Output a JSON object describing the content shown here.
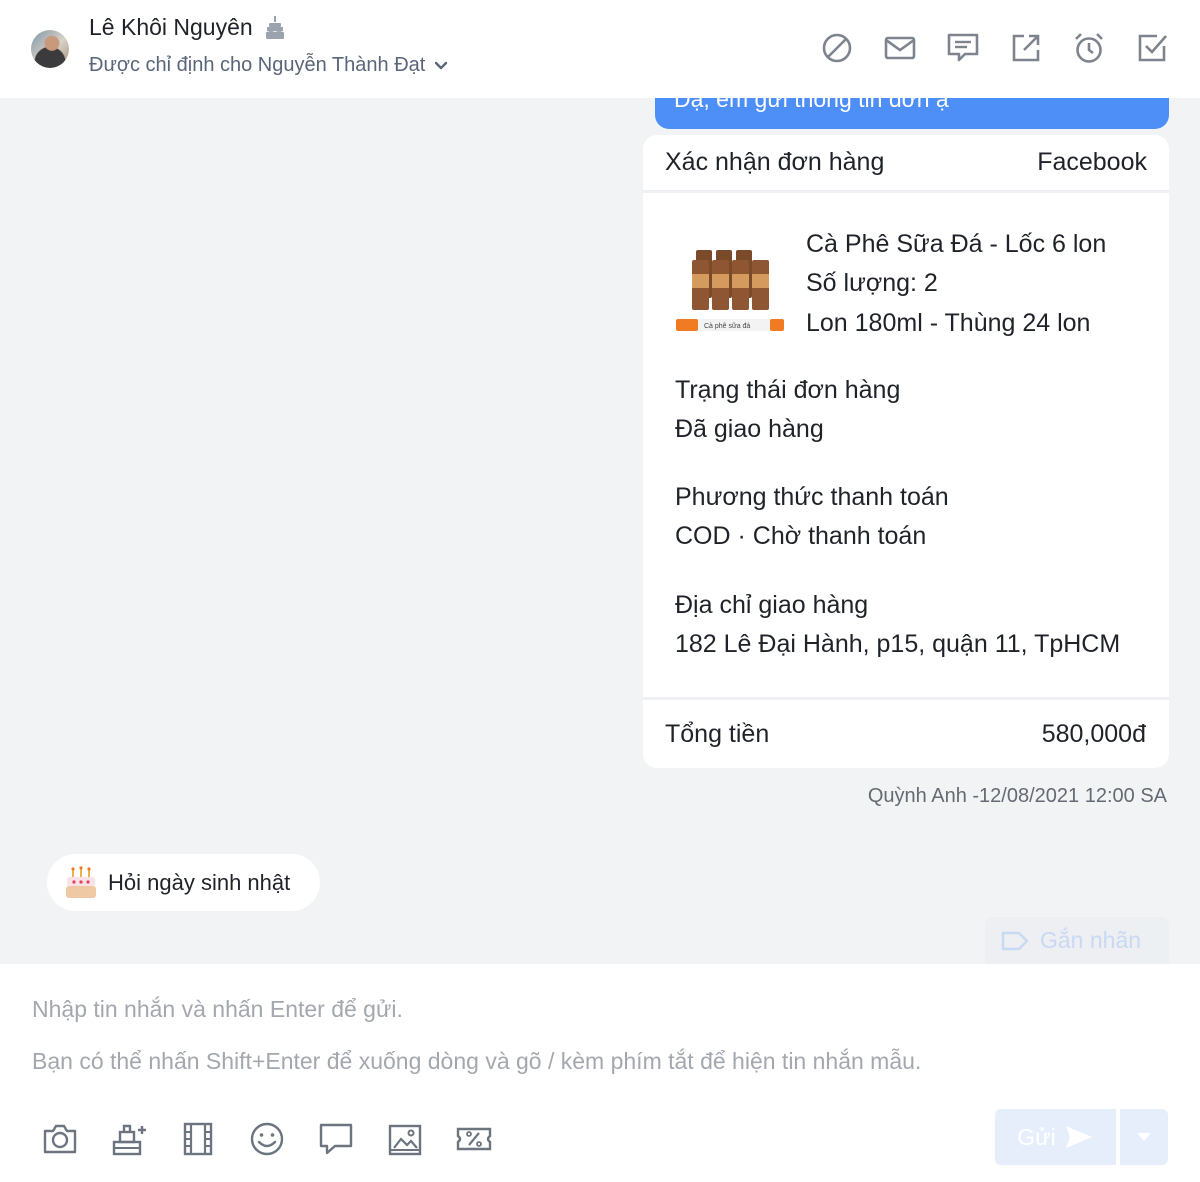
{
  "header": {
    "contact_name": "Lê Khôi Nguyên",
    "assigned_to": "Được chỉ định cho Nguyễn Thành Đạt",
    "icons": [
      "block-icon",
      "mail-icon",
      "comment-icon",
      "open-external-icon",
      "alarm-icon",
      "check-square-icon"
    ]
  },
  "conversation": {
    "top_bubble_text": "Dạ, em gửi thông tin đơn ạ",
    "order_card": {
      "title": "Xác nhận đơn hàng",
      "channel": "Facebook",
      "product": {
        "name": "Cà Phê Sữa Đá - Lốc 6 lon",
        "quantity": "Số lượng: 2",
        "variant": "Lon 180ml - Thùng 24 lon",
        "image_caption": "Cà phê sữa đá"
      },
      "status_label": "Trạng thái đơn hàng",
      "status_value": "Đã giao hàng",
      "payment_label": "Phương thức thanh toán",
      "payment_value": "COD · Chờ thanh toán",
      "address_label": "Địa chỉ giao hàng",
      "address_value": "182 Lê Đại Hành, p15, quận 11, TpHCM",
      "total_label": "Tổng tiền",
      "total_value": "580,000đ"
    },
    "message_meta": "Quỳnh Anh -12/08/2021 12:00 SA",
    "suggestion_chip": "Hỏi ngày sinh nhật",
    "tag_button": "Gắn nhãn"
  },
  "composer": {
    "placeholder_line1": "Nhập tin nhắn và nhấn Enter để gửi.",
    "placeholder_line2": "Bạn có thể nhấn Shift+Enter để xuống dòng và gõ / kèm phím tắt để hiện tin nhắn mẫu.",
    "send_label": "Gửi",
    "tools": [
      "camera-icon",
      "product-icon",
      "video-icon",
      "emoji-icon",
      "chat-template-icon",
      "image-icon",
      "coupon-icon"
    ]
  },
  "colors": {
    "accent": "#4e8ef7",
    "background": "#f2f3f5",
    "card": "#ffffff",
    "muted_text": "#a3a7ae"
  }
}
